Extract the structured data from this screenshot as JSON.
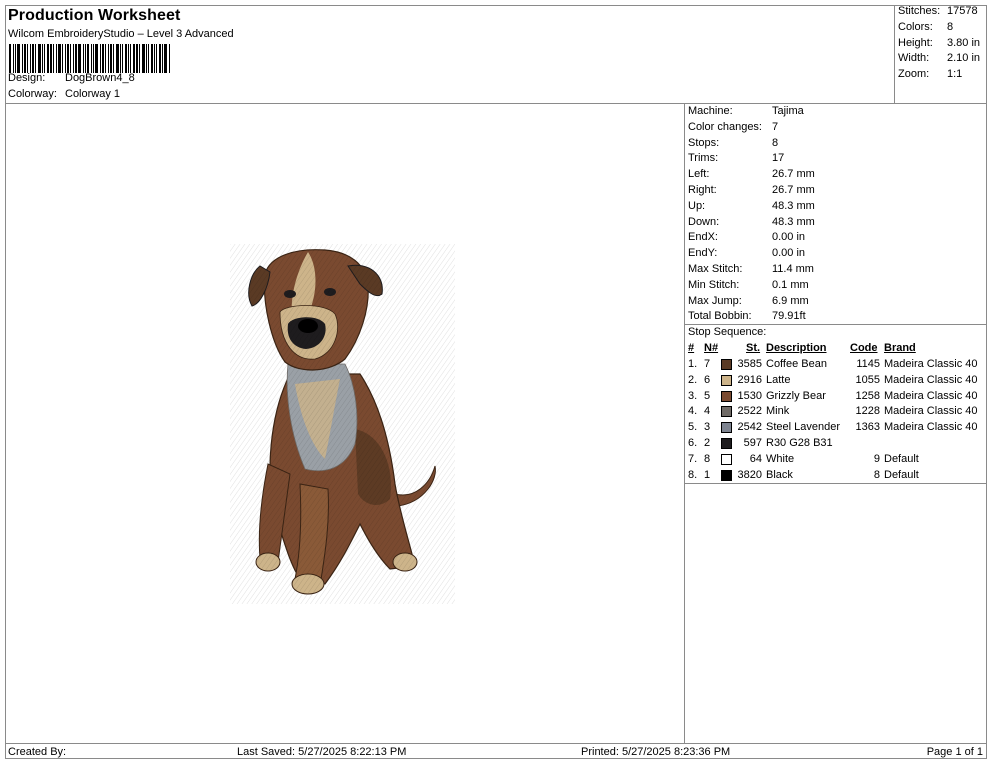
{
  "header": {
    "title": "Production Worksheet",
    "subtitle": "Wilcom EmbroideryStudio – Level 3 Advanced",
    "design_label": "Design:",
    "design_value": "DogBrown4_8",
    "colorway_label": "Colorway:",
    "colorway_value": "Colorway 1"
  },
  "stats": [
    {
      "label": "Stitches:",
      "value": "17578"
    },
    {
      "label": "Colors:",
      "value": "8"
    },
    {
      "label": "Height:",
      "value": "3.80 in"
    },
    {
      "label": "Width:",
      "value": "2.10 in"
    },
    {
      "label": "Zoom:",
      "value": "1:1"
    }
  ],
  "machine_info": [
    {
      "label": "Machine:",
      "value": "Tajima"
    },
    {
      "label": "Color changes:",
      "value": "7"
    },
    {
      "label": "Stops:",
      "value": "8"
    },
    {
      "label": "Trims:",
      "value": "17"
    },
    {
      "label": "Left:",
      "value": "26.7 mm"
    },
    {
      "label": "Right:",
      "value": "26.7 mm"
    },
    {
      "label": "Up:",
      "value": "48.3 mm"
    },
    {
      "label": "Down:",
      "value": "48.3 mm"
    },
    {
      "label": "EndX:",
      "value": "0.00 in"
    },
    {
      "label": "EndY:",
      "value": "0.00 in"
    },
    {
      "label": "Max Stitch:",
      "value": "11.4 mm"
    },
    {
      "label": "Min Stitch:",
      "value": "0.1 mm"
    },
    {
      "label": "Max Jump:",
      "value": "6.9 mm"
    },
    {
      "label": "Total Bobbin:",
      "value": "79.91ft"
    }
  ],
  "stop_sequence": {
    "title": "Stop Sequence:",
    "headers": {
      "num": "#",
      "n": "N#",
      "st": "St.",
      "description": "Description",
      "code": "Code",
      "brand": "Brand"
    },
    "rows": [
      {
        "num": "1.",
        "n": "7",
        "color": "#5a3a24",
        "st": "3585",
        "description": "Coffee Bean",
        "code": "1145",
        "brand": "Madeira Classic 40"
      },
      {
        "num": "2.",
        "n": "6",
        "color": "#cdb48a",
        "st": "2916",
        "description": "Latte",
        "code": "1055",
        "brand": "Madeira Classic 40"
      },
      {
        "num": "3.",
        "n": "5",
        "color": "#7a4a30",
        "st": "1530",
        "description": "Grizzly Bear",
        "code": "1258",
        "brand": "Madeira Classic 40"
      },
      {
        "num": "4.",
        "n": "4",
        "color": "#6f6a66",
        "st": "2522",
        "description": "Mink",
        "code": "1228",
        "brand": "Madeira Classic 40"
      },
      {
        "num": "5.",
        "n": "3",
        "color": "#7e8490",
        "st": "2542",
        "description": "Steel Lavender",
        "code": "1363",
        "brand": "Madeira Classic 40"
      },
      {
        "num": "6.",
        "n": "2",
        "color": "#1e1c1e",
        "st": "597",
        "description": "R30 G28 B31",
        "code": "",
        "brand": ""
      },
      {
        "num": "7.",
        "n": "8",
        "color": "#ffffff",
        "st": "64",
        "description": "White",
        "code": "9",
        "brand": "Default"
      },
      {
        "num": "8.",
        "n": "1",
        "color": "#000000",
        "st": "3820",
        "description": "Black",
        "code": "8",
        "brand": "Default"
      }
    ]
  },
  "footer": {
    "created_by": "Created By:",
    "last_saved": "Last Saved: 5/27/2025 8:22:13 PM",
    "printed": "Printed: 5/27/2025 8:23:36 PM",
    "page": "Page 1 of 1"
  }
}
